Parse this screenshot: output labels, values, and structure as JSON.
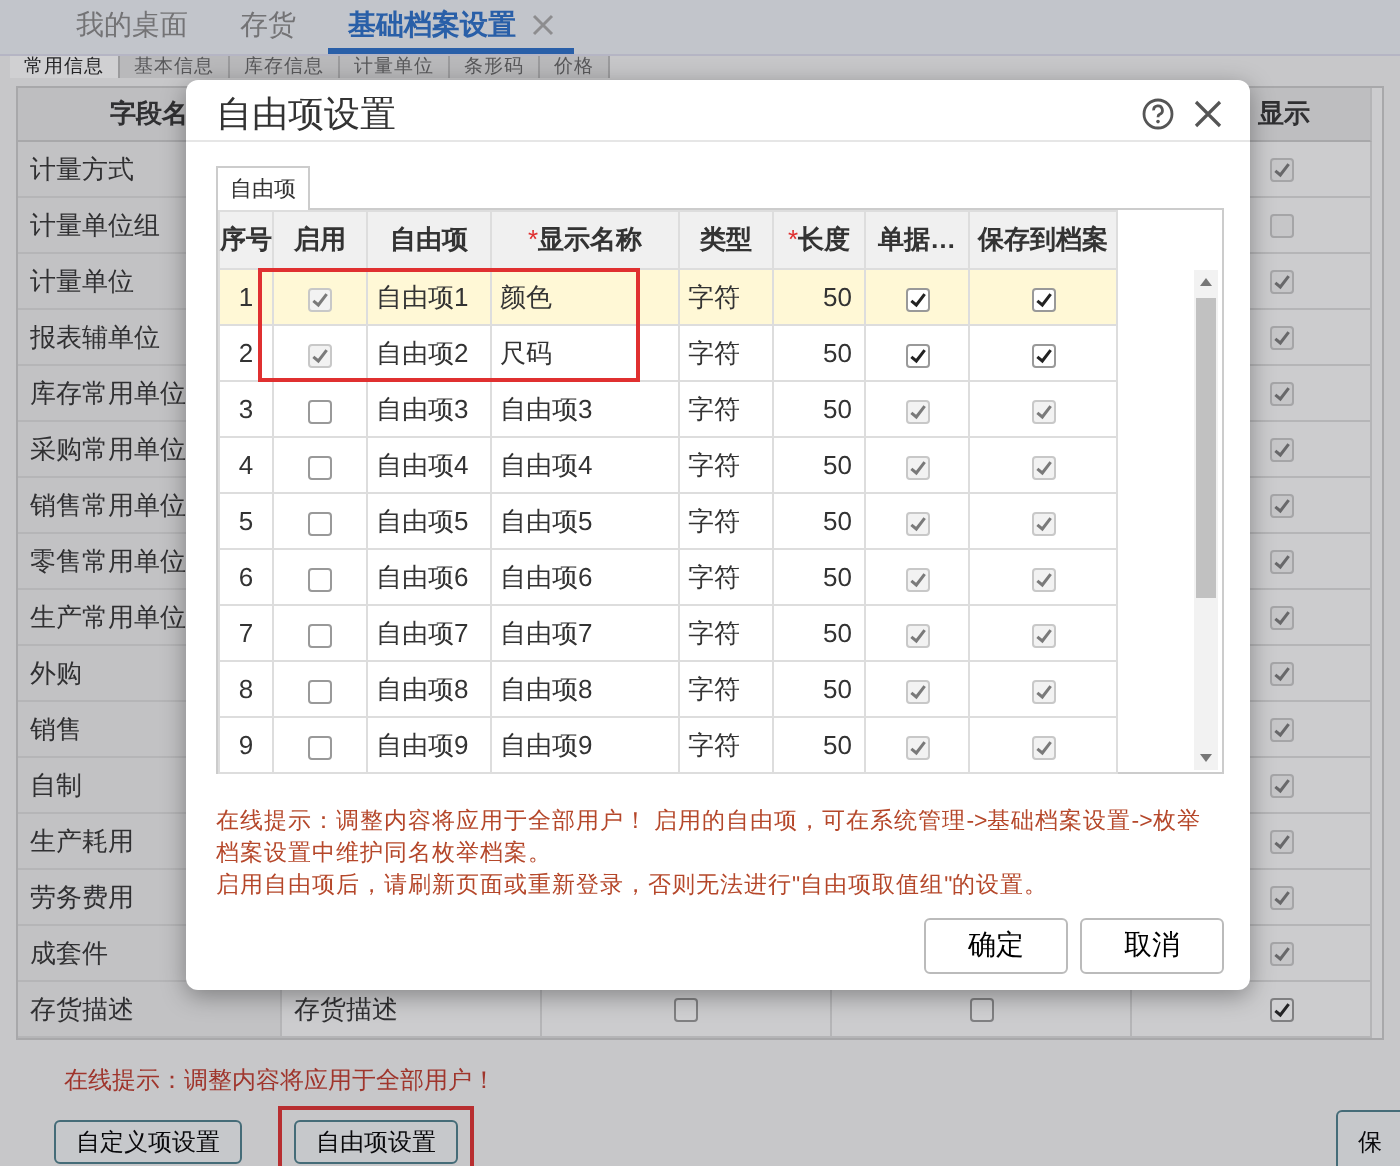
{
  "tabs": [
    {
      "label": "我的桌面",
      "selected": false,
      "closable": false
    },
    {
      "label": "存货",
      "selected": false,
      "closable": false
    },
    {
      "label": "基础档案设置",
      "selected": true,
      "closable": true
    }
  ],
  "subtabs": [
    {
      "label": "常用信息",
      "selected": true
    },
    {
      "label": "基本信息",
      "selected": false
    },
    {
      "label": "库存信息",
      "selected": false
    },
    {
      "label": "计量单位",
      "selected": false
    },
    {
      "label": "条形码",
      "selected": false
    },
    {
      "label": "价格",
      "selected": false
    }
  ],
  "field_table": {
    "name_header": "字段名",
    "display_header": "显示",
    "rows": [
      {
        "name": "计量方式",
        "display": {
          "checked": true,
          "disabled": true
        }
      },
      {
        "name": "计量单位组",
        "display": {
          "checked": false,
          "disabled": true
        }
      },
      {
        "name": "计量单位",
        "display": {
          "checked": true,
          "disabled": true
        }
      },
      {
        "name": "报表辅单位",
        "display": {
          "checked": true,
          "disabled": true
        }
      },
      {
        "name": "库存常用单位",
        "display": {
          "checked": true,
          "disabled": true
        }
      },
      {
        "name": "采购常用单位",
        "display": {
          "checked": true,
          "disabled": true
        }
      },
      {
        "name": "销售常用单位",
        "display": {
          "checked": true,
          "disabled": true
        }
      },
      {
        "name": "零售常用单位",
        "display": {
          "checked": true,
          "disabled": true
        }
      },
      {
        "name": "生产常用单位",
        "display": {
          "checked": true,
          "disabled": true
        }
      },
      {
        "name": "外购",
        "display": {
          "checked": true,
          "disabled": true
        }
      },
      {
        "name": "销售",
        "display": {
          "checked": true,
          "disabled": true
        }
      },
      {
        "name": "自制",
        "display": {
          "checked": true,
          "disabled": true
        }
      },
      {
        "name": "生产耗用",
        "display": {
          "checked": true,
          "disabled": true
        }
      },
      {
        "name": "劳务费用",
        "display": {
          "checked": true,
          "disabled": true
        }
      },
      {
        "name": "成套件",
        "display": {
          "checked": true,
          "disabled": true
        }
      },
      {
        "name": "存货描述",
        "column_2": "存货描述",
        "column_3": {
          "checked": false,
          "disabled": false
        },
        "column_4": {
          "checked": false,
          "disabled": false
        },
        "display": {
          "checked": true,
          "disabled": false
        }
      }
    ]
  },
  "footer": {
    "tip": "在线提示：调整内容将应用于全部用户！",
    "buttons": [
      {
        "label": "自定义项设置",
        "highlighted": false,
        "cut": false
      },
      {
        "label": "自由项设置",
        "highlighted": true,
        "cut": false
      },
      {
        "label": "保",
        "highlighted": false,
        "cut": true
      }
    ]
  },
  "dialog": {
    "title": "自由项设置",
    "tabs": [
      {
        "label": "自由项",
        "selected": true
      }
    ],
    "columns": [
      {
        "label": "序号"
      },
      {
        "label": "启用"
      },
      {
        "label": "自由项"
      },
      {
        "label": "显示名称",
        "mark": "*"
      },
      {
        "label": "类型"
      },
      {
        "label": "长度",
        "mark": "*"
      },
      {
        "label": "单据…"
      },
      {
        "label": "保存到档案"
      }
    ],
    "rows": [
      {
        "index": "1",
        "enabled": {
          "checked": true,
          "disabled": true
        },
        "item": "自由项1",
        "display_name": "颜色",
        "type": "字符",
        "length": "50",
        "on_document": {
          "checked": true,
          "disabled": false
        },
        "save_to_archive": {
          "checked": true,
          "disabled": false
        },
        "selected": true,
        "highlighted": true
      },
      {
        "index": "2",
        "enabled": {
          "checked": true,
          "disabled": true
        },
        "item": "自由项2",
        "display_name": "尺码",
        "type": "字符",
        "length": "50",
        "on_document": {
          "checked": true,
          "disabled": false
        },
        "save_to_archive": {
          "checked": true,
          "disabled": false
        },
        "selected": false,
        "highlighted": true
      },
      {
        "index": "3",
        "enabled": {
          "checked": false,
          "disabled": false
        },
        "item": "自由项3",
        "display_name": "自由项3",
        "type": "字符",
        "length": "50",
        "on_document": {
          "checked": true,
          "disabled": true
        },
        "save_to_archive": {
          "checked": true,
          "disabled": true
        },
        "selected": false,
        "highlighted": false
      },
      {
        "index": "4",
        "enabled": {
          "checked": false,
          "disabled": false
        },
        "item": "自由项4",
        "display_name": "自由项4",
        "type": "字符",
        "length": "50",
        "on_document": {
          "checked": true,
          "disabled": true
        },
        "save_to_archive": {
          "checked": true,
          "disabled": true
        },
        "selected": false,
        "highlighted": false
      },
      {
        "index": "5",
        "enabled": {
          "checked": false,
          "disabled": false
        },
        "item": "自由项5",
        "display_name": "自由项5",
        "type": "字符",
        "length": "50",
        "on_document": {
          "checked": true,
          "disabled": true
        },
        "save_to_archive": {
          "checked": true,
          "disabled": true
        },
        "selected": false,
        "highlighted": false
      },
      {
        "index": "6",
        "enabled": {
          "checked": false,
          "disabled": false
        },
        "item": "自由项6",
        "display_name": "自由项6",
        "type": "字符",
        "length": "50",
        "on_document": {
          "checked": true,
          "disabled": true
        },
        "save_to_archive": {
          "checked": true,
          "disabled": true
        },
        "selected": false,
        "highlighted": false
      },
      {
        "index": "7",
        "enabled": {
          "checked": false,
          "disabled": false
        },
        "item": "自由项7",
        "display_name": "自由项7",
        "type": "字符",
        "length": "50",
        "on_document": {
          "checked": true,
          "disabled": true
        },
        "save_to_archive": {
          "checked": true,
          "disabled": true
        },
        "selected": false,
        "highlighted": false
      },
      {
        "index": "8",
        "enabled": {
          "checked": false,
          "disabled": false
        },
        "item": "自由项8",
        "display_name": "自由项8",
        "type": "字符",
        "length": "50",
        "on_document": {
          "checked": true,
          "disabled": true
        },
        "save_to_archive": {
          "checked": true,
          "disabled": true
        },
        "selected": false,
        "highlighted": false
      },
      {
        "index": "9",
        "enabled": {
          "checked": false,
          "disabled": false
        },
        "item": "自由项9",
        "display_name": "自由项9",
        "type": "字符",
        "length": "50",
        "on_document": {
          "checked": true,
          "disabled": true
        },
        "save_to_archive": {
          "checked": true,
          "disabled": true
        },
        "selected": false,
        "highlighted": false
      }
    ],
    "notes": [
      "在线提示：调整内容将应用于全部用户！ 启用的自由项，可在系统管理->基础档案设置->枚举档案设置中维护同名枚举档案。",
      "启用自由项后，请刷新页面或重新登录，否则无法进行\"自由项取值组\"的设置。"
    ],
    "buttons": [
      {
        "label": "确定"
      },
      {
        "label": "取消"
      }
    ]
  }
}
